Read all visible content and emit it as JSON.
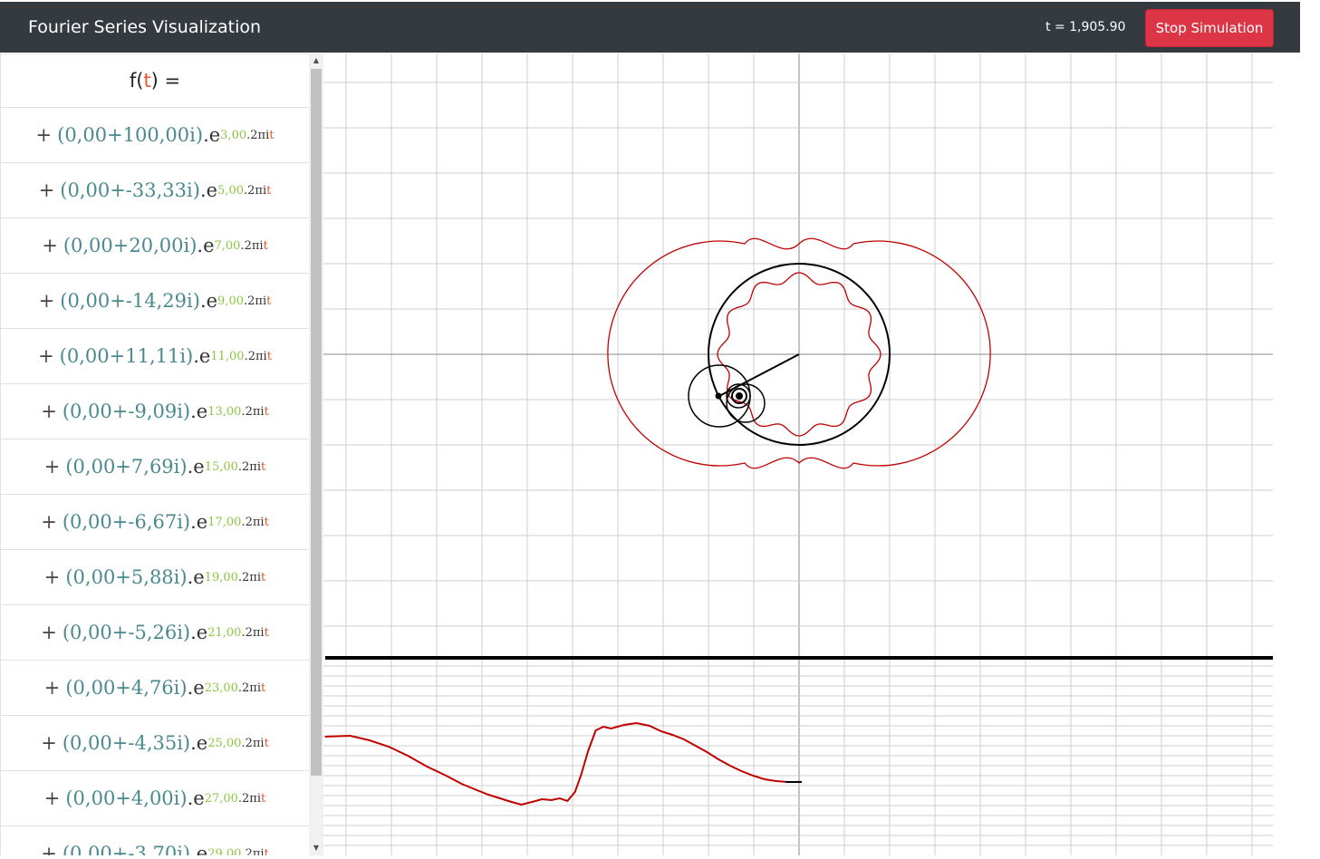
{
  "app": {
    "title": "Fourier Series Visualization",
    "t_label": "t = 1,905.90",
    "stop_button": "Stop Simulation"
  },
  "formula": {
    "lhs_f": "f(",
    "lhs_t": "t",
    "lhs_close": ") ="
  },
  "terms": [
    {
      "coef": "(0,00+100,00i)",
      "freq": "3,00"
    },
    {
      "coef": "(0,00+-33,33i)",
      "freq": "5,00"
    },
    {
      "coef": "(0,00+20,00i)",
      "freq": "7,00"
    },
    {
      "coef": "(0,00+-14,29i)",
      "freq": "9,00"
    },
    {
      "coef": "(0,00+11,11i)",
      "freq": "11,00"
    },
    {
      "coef": "(0,00+-9,09i)",
      "freq": "13,00"
    },
    {
      "coef": "(0,00+7,69i)",
      "freq": "15,00"
    },
    {
      "coef": "(0,00+-6,67i)",
      "freq": "17,00"
    },
    {
      "coef": "(0,00+5,88i)",
      "freq": "19,00"
    },
    {
      "coef": "(0,00+-5,26i)",
      "freq": "21,00"
    },
    {
      "coef": "(0,00+4,76i)",
      "freq": "23,00"
    },
    {
      "coef": "(0,00+-4,35i)",
      "freq": "25,00"
    },
    {
      "coef": "(0,00+4,00i)",
      "freq": "27,00"
    },
    {
      "coef": "(0,00+-3,70i)",
      "freq": "29,00"
    }
  ],
  "term_parts": {
    "plus": "+",
    "e": ".e",
    "two_pi_i": ".2πi",
    "t": "t"
  },
  "colors": {
    "navbar": "#343a40",
    "stop_button": "#dc3545",
    "path": "#c00000",
    "coefficient": "#4a8a8f",
    "frequency": "#8dc63f",
    "variable": "#e8572a"
  },
  "icons": {
    "scroll_up": "scroll-up-arrow-icon",
    "scroll_down": "scroll-down-arrow-icon"
  }
}
